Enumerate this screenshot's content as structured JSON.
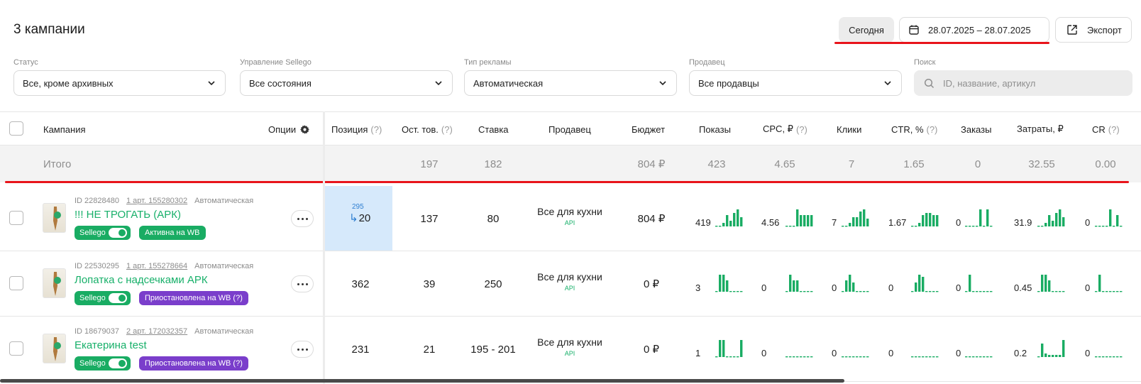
{
  "header": {
    "title": "3 кампании",
    "today_label": "Сегодня",
    "date_range": "28.07.2025 – 28.07.2025",
    "export_label": "Экспорт"
  },
  "filters": {
    "status": {
      "label": "Статус",
      "value": "Все, кроме архивных"
    },
    "management": {
      "label": "Управление Sellego",
      "value": "Все состояния"
    },
    "ad_type": {
      "label": "Тип рекламы",
      "value": "Автоматическая"
    },
    "seller": {
      "label": "Продавец",
      "value": "Все продавцы"
    },
    "search": {
      "label": "Поиск",
      "placeholder": "ID, название, артикул"
    }
  },
  "columns": {
    "campaign": "Кампания",
    "options": "Опции",
    "position": "Позиция",
    "stock": "Ост. тов.",
    "bid": "Ставка",
    "seller": "Продавец",
    "budget": "Бюджет",
    "views": "Показы",
    "cpc": "CPC, ₽",
    "clicks": "Клики",
    "ctr": "CTR, %",
    "orders": "Заказы",
    "costs": "Затраты, ₽",
    "cr": "CR",
    "hint": "(?)"
  },
  "totals": {
    "label": "Итого",
    "stock": "197",
    "bid": "182",
    "budget": "804 ₽",
    "views": "423",
    "cpc": "4.65",
    "clicks": "7",
    "ctr": "1.65",
    "orders": "0",
    "costs": "32.55",
    "cr": "0.00"
  },
  "rows": [
    {
      "id": "ID 22828480",
      "art": "1 арт. 155280302",
      "type": "Автоматическая",
      "name": "!!! НЕ ТРОГАТЬ (АРК)",
      "sellego": "Sellego",
      "status": "Активна на WB",
      "status_color": "#19ac63",
      "position_prev": "295",
      "position": "20",
      "stock": "137",
      "bid": "80",
      "seller": "Все для кухни",
      "seller_tag": "API",
      "budget": "804 ₽",
      "views": "419",
      "cpc": "4.56",
      "clicks": "7",
      "ctr": "1.67",
      "orders": "0",
      "costs": "31.9",
      "cr": "0",
      "sparks": {
        "views": [
          0,
          0,
          2,
          6,
          3,
          7,
          9,
          5
        ],
        "cpc": [
          0,
          0,
          0,
          9,
          6,
          6,
          6,
          6
        ],
        "clicks": [
          0,
          0,
          2,
          5,
          5,
          8,
          9,
          4
        ],
        "ctr": [
          0,
          0,
          2,
          6,
          7,
          7,
          6,
          6
        ],
        "orders": [
          0,
          0,
          0,
          0,
          9,
          0,
          9,
          0
        ],
        "costs": [
          0,
          0,
          2,
          6,
          3,
          7,
          9,
          5
        ],
        "cr": [
          0,
          0,
          0,
          0,
          9,
          0,
          6,
          0
        ]
      }
    },
    {
      "id": "ID 22530295",
      "art": "1 арт. 155278664",
      "type": "Автоматическая",
      "name": "Лопатка с надсечками АРК",
      "sellego": "Sellego",
      "status": "Приостановлена на WB (?)",
      "status_color": "#7a3ecb",
      "position_prev": "",
      "position": "362",
      "stock": "39",
      "bid": "250",
      "seller": "Все для кухни",
      "seller_tag": "API",
      "budget": "0 ₽",
      "views": "3",
      "cpc": "0",
      "clicks": "0",
      "ctr": "0",
      "orders": "0",
      "costs": "0.45",
      "cr": "0",
      "sparks": {
        "views": [
          0,
          9,
          9,
          6,
          0,
          0,
          0,
          0
        ],
        "cpc": [
          0,
          9,
          6,
          6,
          0,
          0,
          0,
          0
        ],
        "clicks": [
          0,
          6,
          9,
          5,
          0,
          0,
          0,
          0
        ],
        "ctr": [
          0,
          5,
          9,
          8,
          0,
          0,
          0,
          0
        ],
        "orders": [
          0,
          9,
          0,
          0,
          0,
          0,
          0,
          0
        ],
        "costs": [
          0,
          9,
          9,
          6,
          0,
          0,
          0,
          0
        ],
        "cr": [
          0,
          9,
          0,
          0,
          0,
          0,
          0,
          0
        ]
      }
    },
    {
      "id": "ID 18679037",
      "art": "2 арт. 172032357",
      "type": "Автоматическая",
      "name": "Екатерина test",
      "sellego": "Sellego",
      "status": "Приостановлена на WB (?)",
      "status_color": "#7a3ecb",
      "position_prev": "",
      "position": "231",
      "stock": "21",
      "bid": "195 - 201",
      "seller": "Все для кухни",
      "seller_tag": "API",
      "budget": "0 ₽",
      "views": "1",
      "cpc": "0",
      "clicks": "0",
      "ctr": "0",
      "orders": "0",
      "costs": "0.2",
      "cr": "0",
      "sparks": {
        "views": [
          0,
          9,
          9,
          0,
          0,
          0,
          0,
          9
        ],
        "cpc": [
          0,
          0,
          0,
          0,
          0,
          0,
          0,
          0
        ],
        "clicks": [
          0,
          0,
          0,
          0,
          0,
          0,
          0,
          0
        ],
        "ctr": [
          0,
          0,
          0,
          0,
          0,
          0,
          0,
          0
        ],
        "orders": [
          0,
          0,
          0,
          0,
          0,
          0,
          0,
          0
        ],
        "costs": [
          0,
          7,
          2,
          1,
          1,
          1,
          1,
          9
        ],
        "cr": [
          0,
          0,
          0,
          0,
          0,
          0,
          0,
          0
        ]
      }
    }
  ]
}
